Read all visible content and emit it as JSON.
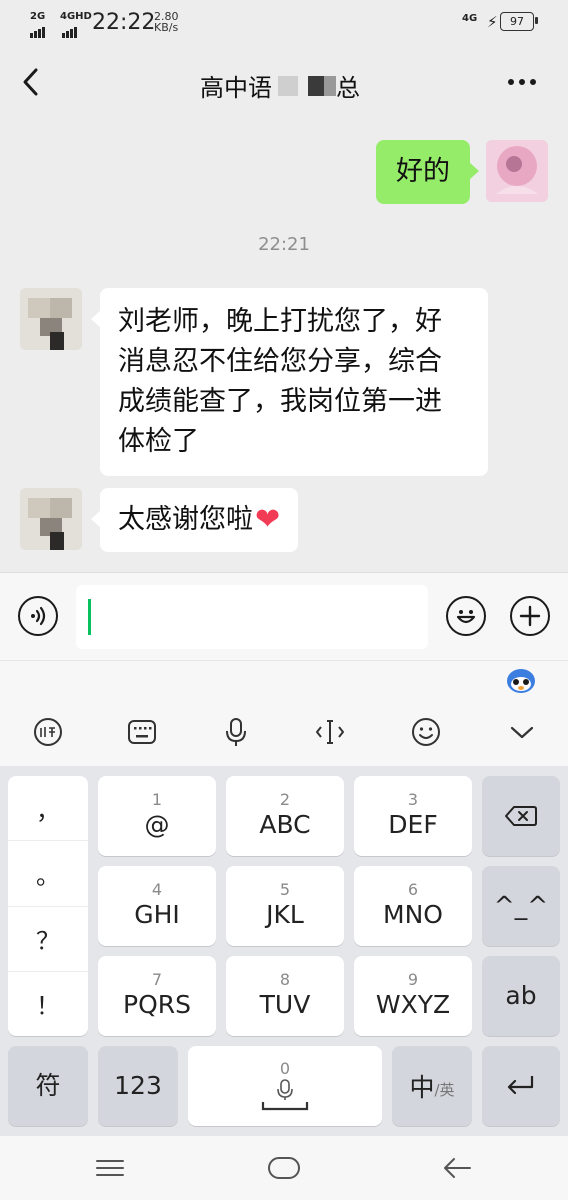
{
  "status": {
    "net1": "2G",
    "net2": "4GHD",
    "time": "22:22",
    "speed_value": "2.80",
    "speed_unit": "KB/s",
    "net_right": "4G",
    "battery": "97"
  },
  "header": {
    "title": "高中语",
    "title_tail": "总"
  },
  "messages": {
    "sent_text": "好的",
    "time_divider": "22:21",
    "recv1_lines": [
      "刘老师，晚上打扰您了，好",
      "消息忍不住给您分享，综合",
      "成绩能查了，我岗位第一进",
      "体检了"
    ],
    "recv2_text": "太感谢您啦",
    "recv2_emoji": "❤"
  },
  "keyboard": {
    "left_col": [
      "，",
      "。",
      "？",
      "！"
    ],
    "keys": [
      {
        "num": "1",
        "label": "@"
      },
      {
        "num": "2",
        "label": "ABC"
      },
      {
        "num": "3",
        "label": "DEF"
      },
      {
        "num": "4",
        "label": "GHI"
      },
      {
        "num": "5",
        "label": "JKL"
      },
      {
        "num": "6",
        "label": "MNO"
      },
      {
        "num": "7",
        "label": "PQRS"
      },
      {
        "num": "8",
        "label": "TUV"
      },
      {
        "num": "9",
        "label": "WXYZ"
      }
    ],
    "emoticon_key": "^_^",
    "ab_key": "ab",
    "symbol_key": "符",
    "num_key": "123",
    "space_num": "0",
    "lang_main": "中",
    "lang_sub": "/英"
  },
  "colors": {
    "sent_bubble": "#95ec69",
    "cursor": "#07c160"
  }
}
